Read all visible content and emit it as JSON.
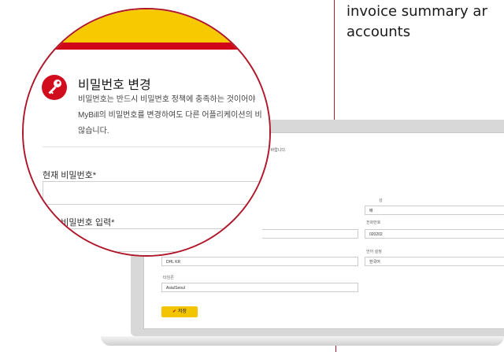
{
  "caption": {
    "line1": "invoice summary ar",
    "line2": "accounts"
  },
  "password_change": {
    "title": "비밀번호 변경",
    "description_lines": [
      "비밀번호는 반드시 비밀번호 정책에 충족하는 것이어야",
      "MyBill의 비밀번호를 변경하여도 다른 어플리케이션의 비",
      "않습니다."
    ],
    "current_password_label": "현재 비밀번호*",
    "new_password_label": "신규 비밀번호 입력*"
  },
  "background_form": {
    "note": "시기 바랍니다.",
    "labels": {
      "last_name": "성",
      "phone": "전화번호",
      "language": "언어 설정",
      "timezone": "타임존"
    },
    "values": {
      "last_name": "배",
      "phone": "020202",
      "company": "DHL KR",
      "language": "한국어",
      "timezone": "Asia/Seoul"
    },
    "save_label": "저장"
  },
  "colors": {
    "brand_yellow": "#f7c900",
    "brand_red": "#cf0718"
  },
  "icons": {
    "key": "key-icon",
    "save": "checkmark-icon"
  }
}
